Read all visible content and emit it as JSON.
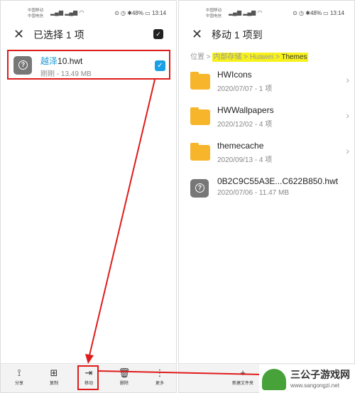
{
  "status": {
    "carrier1": "中国移动",
    "carrier2": "中国电信",
    "battery": "48%",
    "time": "13:14"
  },
  "left": {
    "title": "已选择 1 项",
    "file": {
      "name_highlight": "越泽",
      "name_rest": "10.hwt",
      "meta": "刚刚 - 13.49 MB",
      "checked": true
    },
    "toolbar": [
      {
        "icon": "share-icon",
        "glyph": "⟟",
        "label": "分享"
      },
      {
        "icon": "copy-icon",
        "glyph": "⊞",
        "label": "复制"
      },
      {
        "icon": "move-icon",
        "glyph": "⇥",
        "label": "移动"
      },
      {
        "icon": "delete-icon",
        "glyph": "🗑",
        "label": "删除"
      },
      {
        "icon": "more-icon",
        "glyph": "⋮",
        "label": "更多"
      }
    ]
  },
  "right": {
    "title": "移动 1 项到",
    "breadcrumb": {
      "root": "位置",
      "parts": [
        "内部存储",
        "Huawei",
        "Themes"
      ]
    },
    "items": [
      {
        "type": "folder",
        "name": "HWIcons",
        "meta": "2020/07/07 - 1 项"
      },
      {
        "type": "folder",
        "name": "HWWallpapers",
        "meta": "2020/12/02 - 4 项"
      },
      {
        "type": "folder",
        "name": "themecache",
        "meta": "2020/09/13 - 4 项"
      },
      {
        "type": "file",
        "name": "0B2C9C55A3E...C622B850.hwt",
        "meta": "2020/07/06 - 11.47 MB"
      }
    ],
    "toolbar": {
      "new_folder_label": "新建文件夹"
    }
  },
  "watermark": {
    "name": "三公子游戏网",
    "url": "www.sangongzi.net"
  },
  "colors": {
    "accent": "#1aa0e6",
    "annotation": "#e01b1b",
    "highlight": "#f7f11c",
    "folder": "#f7b52c"
  }
}
